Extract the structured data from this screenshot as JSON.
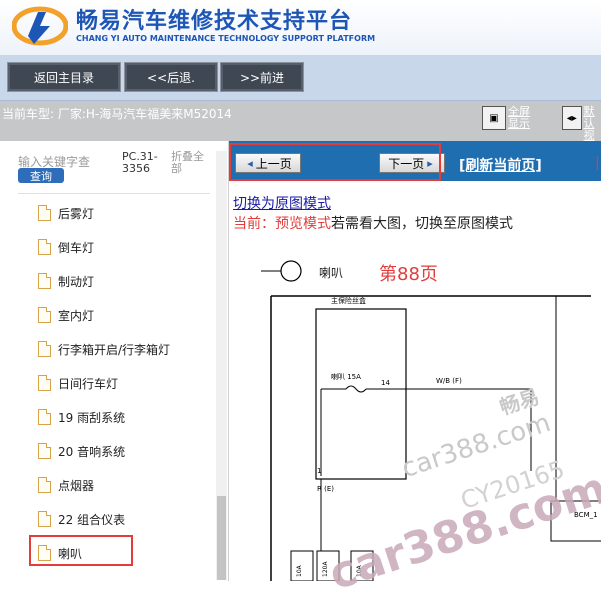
{
  "header": {
    "title": "畅易汽车维修技术支持平台",
    "subtitle": "CHANG YI AUTO MAINTENANCE TECHNOLOGY SUPPORT PLATFORM"
  },
  "nav": {
    "home": "返回主目录",
    "back": "<<后退.",
    "forward": ">>前进"
  },
  "model": {
    "text": "当前车型: 厂家:H-海马汽车福美来M52014"
  },
  "view_buttons": {
    "fullscreen": "全屏",
    "fullscreen_line2": "显示",
    "default": "默认",
    "default_line2": "视图"
  },
  "sidebar": {
    "search_label": "输入关键字查",
    "search_button": "查询",
    "pc_label": "PC.31-3356",
    "fold_label": "折叠全部",
    "items": [
      {
        "label": "后雾灯"
      },
      {
        "label": "倒车灯"
      },
      {
        "label": "制动灯"
      },
      {
        "label": "室内灯"
      },
      {
        "label": "行李箱开启/行李箱灯"
      },
      {
        "label": "日间行车灯"
      },
      {
        "label": "19 雨刮系统"
      },
      {
        "label": "20 音响系统"
      },
      {
        "label": "点烟器"
      },
      {
        "label": "22 组合仪表"
      },
      {
        "label": "喇叭",
        "active": true
      }
    ]
  },
  "toolbar": {
    "prev": "上一页",
    "next": "下一页",
    "refresh": "[刷新当前页]"
  },
  "content": {
    "switch_link": "切换为原图模式",
    "mode_prefix": "当前：预览模式",
    "mode_suffix": "若需看大图，切换至原图模式",
    "page_number": "第88页",
    "diagram": {
      "horn_title": "喇叭",
      "fuse_box": "主保险丝盒",
      "fuse": "喇叭 15A",
      "pin14": "14",
      "wire": "W/B (F)",
      "pin1": "1",
      "wire2": "R (E)",
      "bcm": "BCM_1",
      "fuse_a": "120A",
      "fuse_b": "10A",
      "fuse_c": "10A"
    },
    "watermarks": {
      "w1": "畅易",
      "w2": "car388.com",
      "w3": "CY20165",
      "w4": "car388.com"
    }
  },
  "colors": {
    "brand_blue": "#1d56b5",
    "toolbar_blue": "#1f6fb0",
    "highlight_red": "#e23c3c"
  }
}
